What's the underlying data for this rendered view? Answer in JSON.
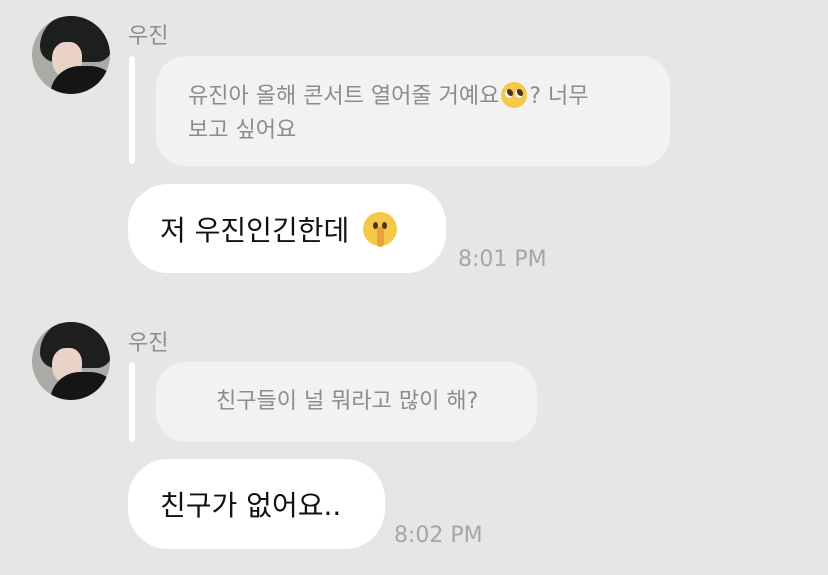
{
  "messages": [
    {
      "sender": "우진",
      "reply_line1": "유진아 올해 콘서트 열어줄 거예요",
      "reply_line1_suffix": "? 너무",
      "reply_line2": "보고 싶어요",
      "reply_emoji": "pleading-face",
      "text": "저 우진인긴한데",
      "text_emoji": "shushing-face",
      "time": "8:01 PM"
    },
    {
      "sender": "우진",
      "reply_line1": "친구들이 널 뭐라고 많이 해?",
      "text": "친구가 없어요..",
      "time": "8:02 PM"
    }
  ],
  "colors": {
    "background": "#e6e6e6",
    "message_bubble": "#ffffff",
    "reply_bubble": "#f2f2f2",
    "reply_text": "#8c8c8c",
    "timestamp": "#a6a6a6"
  }
}
